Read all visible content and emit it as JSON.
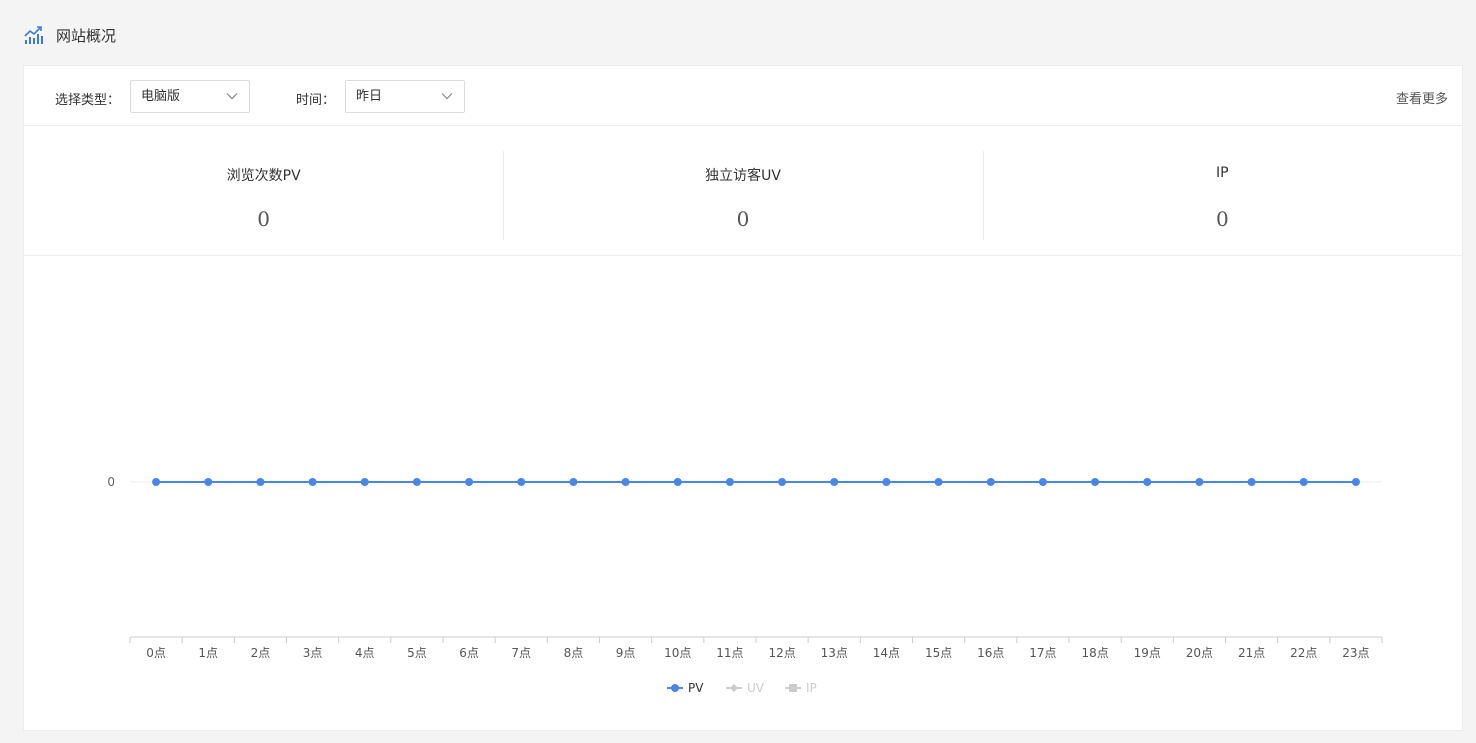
{
  "header": {
    "title": "网站概况",
    "icon": "trend-chart-icon"
  },
  "toolbar": {
    "type_label": "选择类型：",
    "type_value": "电脑版",
    "time_label": "时间：",
    "time_value": "昨日",
    "more_label": "查看更多"
  },
  "stats": [
    {
      "label": "浏览次数PV",
      "value": "0"
    },
    {
      "label": "独立访客UV",
      "value": "0"
    },
    {
      "label": "IP",
      "value": "0"
    }
  ],
  "colors": {
    "pv": "#4a86e8",
    "inactive": "#cccccc",
    "axis": "#cccccc"
  },
  "chart_data": {
    "type": "line",
    "categories": [
      "0点",
      "1点",
      "2点",
      "3点",
      "4点",
      "5点",
      "6点",
      "7点",
      "8点",
      "9点",
      "10点",
      "11点",
      "12点",
      "13点",
      "14点",
      "15点",
      "16点",
      "17点",
      "18点",
      "19点",
      "20点",
      "21点",
      "22点",
      "23点"
    ],
    "series": [
      {
        "name": "PV",
        "values": [
          0,
          0,
          0,
          0,
          0,
          0,
          0,
          0,
          0,
          0,
          0,
          0,
          0,
          0,
          0,
          0,
          0,
          0,
          0,
          0,
          0,
          0,
          0,
          0
        ],
        "active": true,
        "marker": "circle"
      },
      {
        "name": "UV",
        "values": [
          0,
          0,
          0,
          0,
          0,
          0,
          0,
          0,
          0,
          0,
          0,
          0,
          0,
          0,
          0,
          0,
          0,
          0,
          0,
          0,
          0,
          0,
          0,
          0
        ],
        "active": false,
        "marker": "diamond"
      },
      {
        "name": "IP",
        "values": [
          0,
          0,
          0,
          0,
          0,
          0,
          0,
          0,
          0,
          0,
          0,
          0,
          0,
          0,
          0,
          0,
          0,
          0,
          0,
          0,
          0,
          0,
          0,
          0
        ],
        "active": false,
        "marker": "square"
      }
    ],
    "y_ticks": [
      "0"
    ],
    "legend_position": "bottom-center",
    "grid": false
  }
}
